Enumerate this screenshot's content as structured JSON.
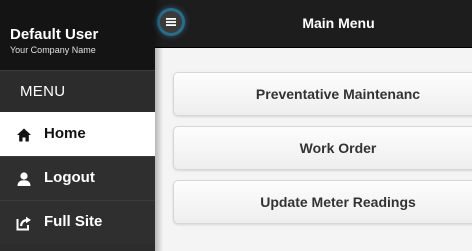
{
  "sidebar": {
    "user_name": "Default User",
    "company_name": "Your Company Name",
    "menu_header": "MENU",
    "items": [
      {
        "label": "Home",
        "icon": "home-icon",
        "active": true
      },
      {
        "label": "Logout",
        "icon": "user-icon",
        "active": false
      },
      {
        "label": "Full Site",
        "icon": "external-link-icon",
        "active": false
      }
    ]
  },
  "header": {
    "title": "Main Menu",
    "toggle_icon": "hamburger-icon"
  },
  "main": {
    "buttons": [
      {
        "label": "Preventative Maintenanc"
      },
      {
        "label": "Work Order"
      },
      {
        "label": "Update Meter Readings"
      }
    ]
  },
  "colors": {
    "sidebar_bg": "#2c2c2c",
    "user_block_bg": "#141414",
    "topbar_bg": "#1d1d1d",
    "main_bg": "#f4f4f4",
    "toggle_glow": "#2a6d8a"
  }
}
